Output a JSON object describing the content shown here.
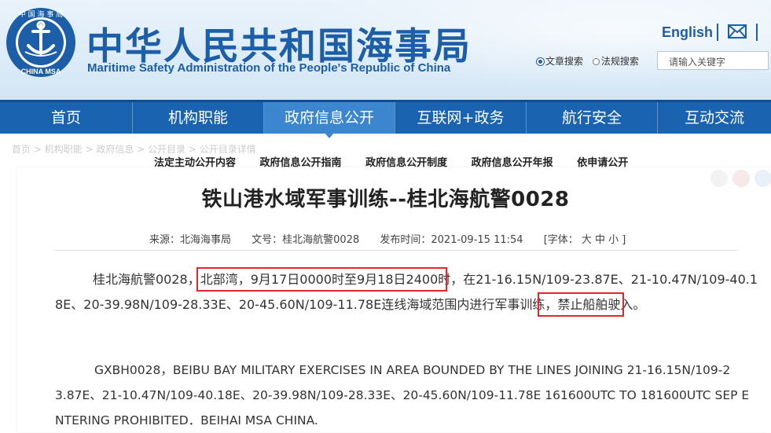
{
  "header": {
    "logo_top_text": "中 国 海 事 局",
    "logo_bottom_text": "CHINA MSA",
    "title_cn": "中华人民共和国海事局",
    "title_en": "Maritime Safety Administration of the People's Republic of China",
    "english_link": "English",
    "search": {
      "option_doc": "文章搜索",
      "option_rule": "法规搜索",
      "placeholder": "请输入关键字"
    }
  },
  "nav": {
    "items": [
      "首页",
      "机构职能",
      "政府信息公开",
      "互联网+政务",
      "航行安全",
      "互动交流"
    ]
  },
  "breadcrumb": "首页  >  机构职能  >  政府信息  >  公开目录  >  公开目录详情",
  "subnav": [
    "法定主动公开内容",
    "政府信息公开指南",
    "政府信息公开制度",
    "政府信息公开年报",
    "依申请公开"
  ],
  "article": {
    "title": "铁山港水域军事训练--桂北海航警0028",
    "meta": {
      "source": "来源：北海海事局",
      "doc_no": "文号：桂北海航警0028",
      "date": "发布时间：2021-09-15 11:54",
      "font": "[字体：  大  中  小 ]"
    },
    "cn_line1_a": "桂北海航警0028，",
    "cn_line1_b": "北部湾，9月17日0000时至9月18日2400时",
    "cn_line1_c": "，在21-16.15N/109-23.87E、21-10.47N/109-40.1",
    "cn_line2_a": "8E、20-39.98N/109-28.33E、20-45.60N/109-11.78E连线海域范围内进行军事训练，",
    "cn_line2_b": "禁止船舶驶入。",
    "en_line1": "GXBH0028，BEIBU BAY MILITARY EXERCISES IN AREA BOUNDED BY THE LINES JOINING 21-16.15N/109-2",
    "en_line2": "3.87E、21-10.47N/109-40.18E、20-39.98N/109-28.33E、20-45.60N/109-11.78E 161600UTC TO 181600UTC SEP E",
    "en_line3": "NTERING PROHIBITED．BEIHAI MSA CHINA."
  },
  "colors": {
    "brand_blue": "#1c5fa8",
    "nav_bg": "#1a63b0",
    "nav_active": "#3b86cf",
    "highlight_red": "#e2262c"
  }
}
